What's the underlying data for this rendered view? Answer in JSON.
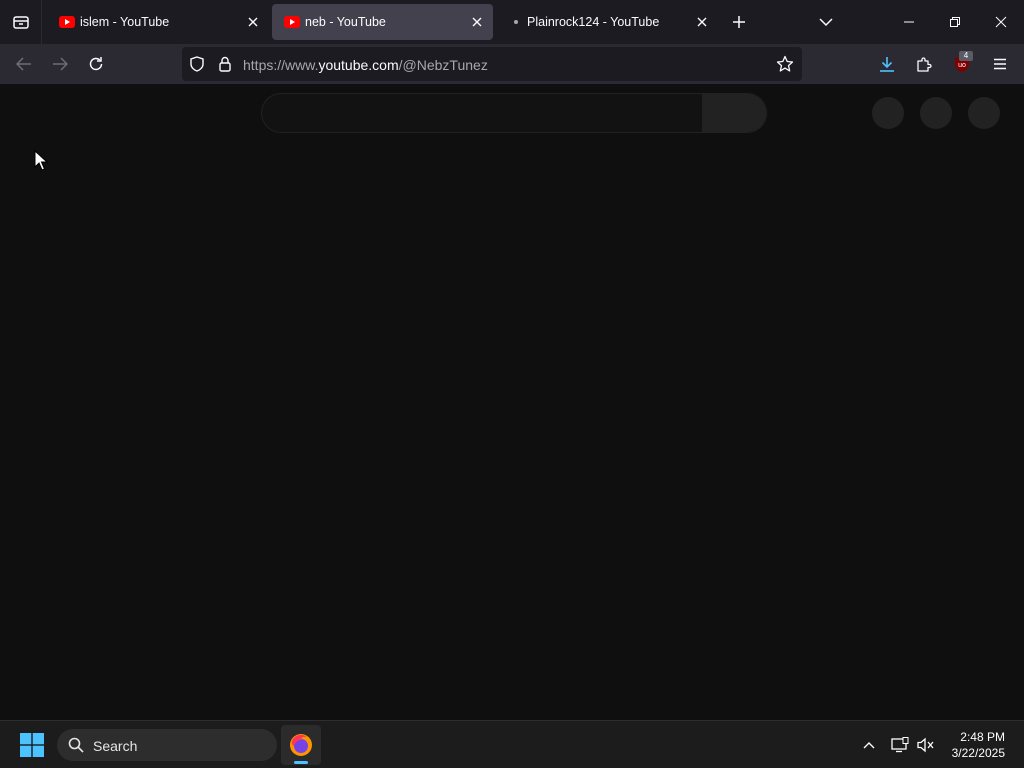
{
  "browser": {
    "tabs": [
      {
        "title": "islem - YouTube",
        "favicon": "youtube-icon",
        "active": false
      },
      {
        "title": "neb - YouTube",
        "favicon": "youtube-icon",
        "active": true
      },
      {
        "title": "Plainrock124 - YouTube",
        "favicon": "loading-dot-icon",
        "active": false
      }
    ],
    "url": {
      "prefix": "https://www.",
      "host": "youtube.com",
      "path": "/@NebzTunez"
    },
    "extension_badge": "4"
  },
  "taskbar": {
    "search_label": "Search",
    "time": "2:48 PM",
    "date": "3/22/2025"
  },
  "colors": {
    "page_bg": "#0f0f0f",
    "tab_strip": "#1c1b22",
    "navbar": "#2b2a33",
    "active_tab": "#42414d",
    "youtube_red": "#ff0000",
    "download_accent": "#4cc2ff"
  }
}
